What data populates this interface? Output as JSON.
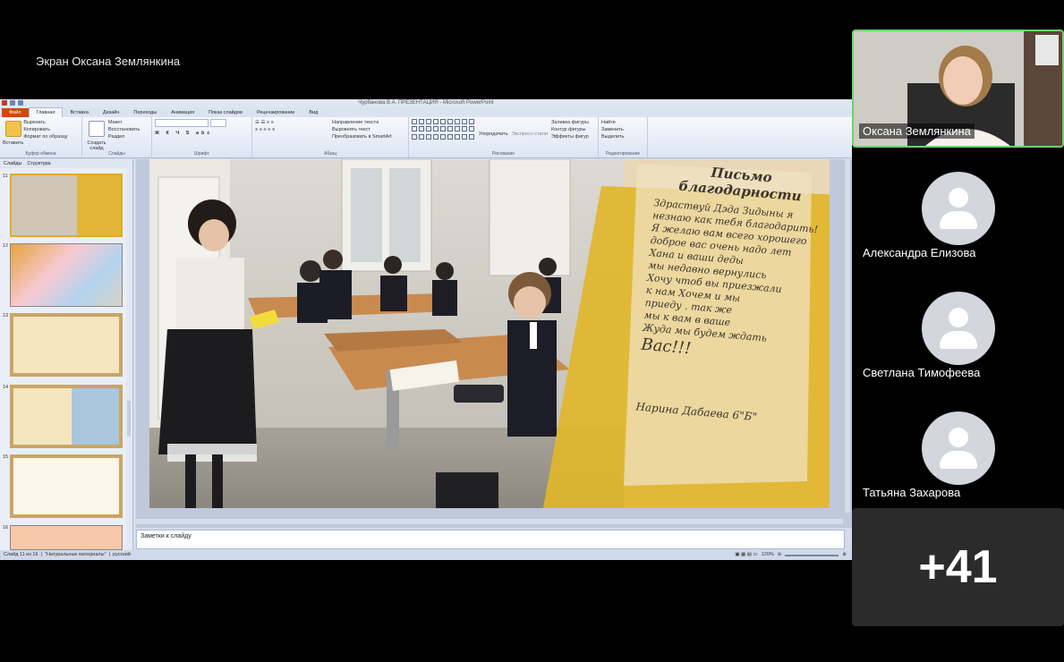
{
  "screen_share": {
    "label": "Экран Оксана Землянкина"
  },
  "ppt": {
    "window_title": "Чурбанова В.А. ПРЕЗЕНТАЦИЯ - Microsoft PowerPoint",
    "tabs": [
      "Файл",
      "Главная",
      "Вставка",
      "Дизайн",
      "Переходы",
      "Анимация",
      "Показ слайдов",
      "Рецензирование",
      "Вид"
    ],
    "ribbon": {
      "clipboard": {
        "paste": "Вставить",
        "cut": "Вырезать",
        "copy": "Копировать",
        "format": "Формат по образцу",
        "name": "Буфер обмена"
      },
      "slides": {
        "create": "Создать слайд",
        "layout": "Макет",
        "reset": "Восстановить",
        "section": "Раздел",
        "name": "Слайды"
      },
      "font": {
        "name": "Шрифт"
      },
      "paragraph": {
        "direction": "Направление текста",
        "align": "Выровнять текст",
        "smartart": "Преобразовать в SmartArt",
        "name": "Абзац"
      },
      "drawing": {
        "arrange": "Упорядочить",
        "styles": "Экспресс-стили",
        "fill": "Заливка фигуры",
        "outline": "Контур фигуры",
        "effects": "Эффекты фигур",
        "name": "Рисование"
      },
      "editing": {
        "find": "Найти",
        "replace": "Заменить",
        "select": "Выделить",
        "name": "Редактирование"
      }
    },
    "panel_tabs": [
      "Слайды",
      "Структура"
    ],
    "thumb_numbers": [
      "11",
      "12",
      "13",
      "14",
      "15",
      "16"
    ],
    "notes_placeholder": "Заметки к слайду",
    "status": {
      "slide": "Слайд 11 из 16",
      "theme": "\"Натуральные материалы\"",
      "lang": "русский",
      "zoom": "120%"
    }
  },
  "letter": {
    "title": "Письмо благодарности",
    "lines": [
      "Здраствуй Дэда Зидыны я",
      "незнаю как тебя благодарить!",
      "Я желаю вам всего хорошего",
      "доброе вас очень надо лет",
      "Хана и ваши деды",
      "мы недавно вернулись",
      "Хочу чтоб вы приезжали",
      "к нам Хочем и мы",
      "приеду . так же",
      "мы к вам в ваше",
      "Жуда мы будем ждать",
      "Вас!!!"
    ],
    "signature": "Нарина Дабаева 6\"Б\""
  },
  "participants": [
    {
      "name": "Оксана Землянкина"
    },
    {
      "name": "Александра Елизова"
    },
    {
      "name": "Светлана Тимофеева"
    },
    {
      "name": "Татьяна Захарова"
    }
  ],
  "more_count": "+41",
  "colors": {
    "active_border": "#6dd36b",
    "tile_bg": "#2b2b2b",
    "file_tab": "#d04a02"
  }
}
